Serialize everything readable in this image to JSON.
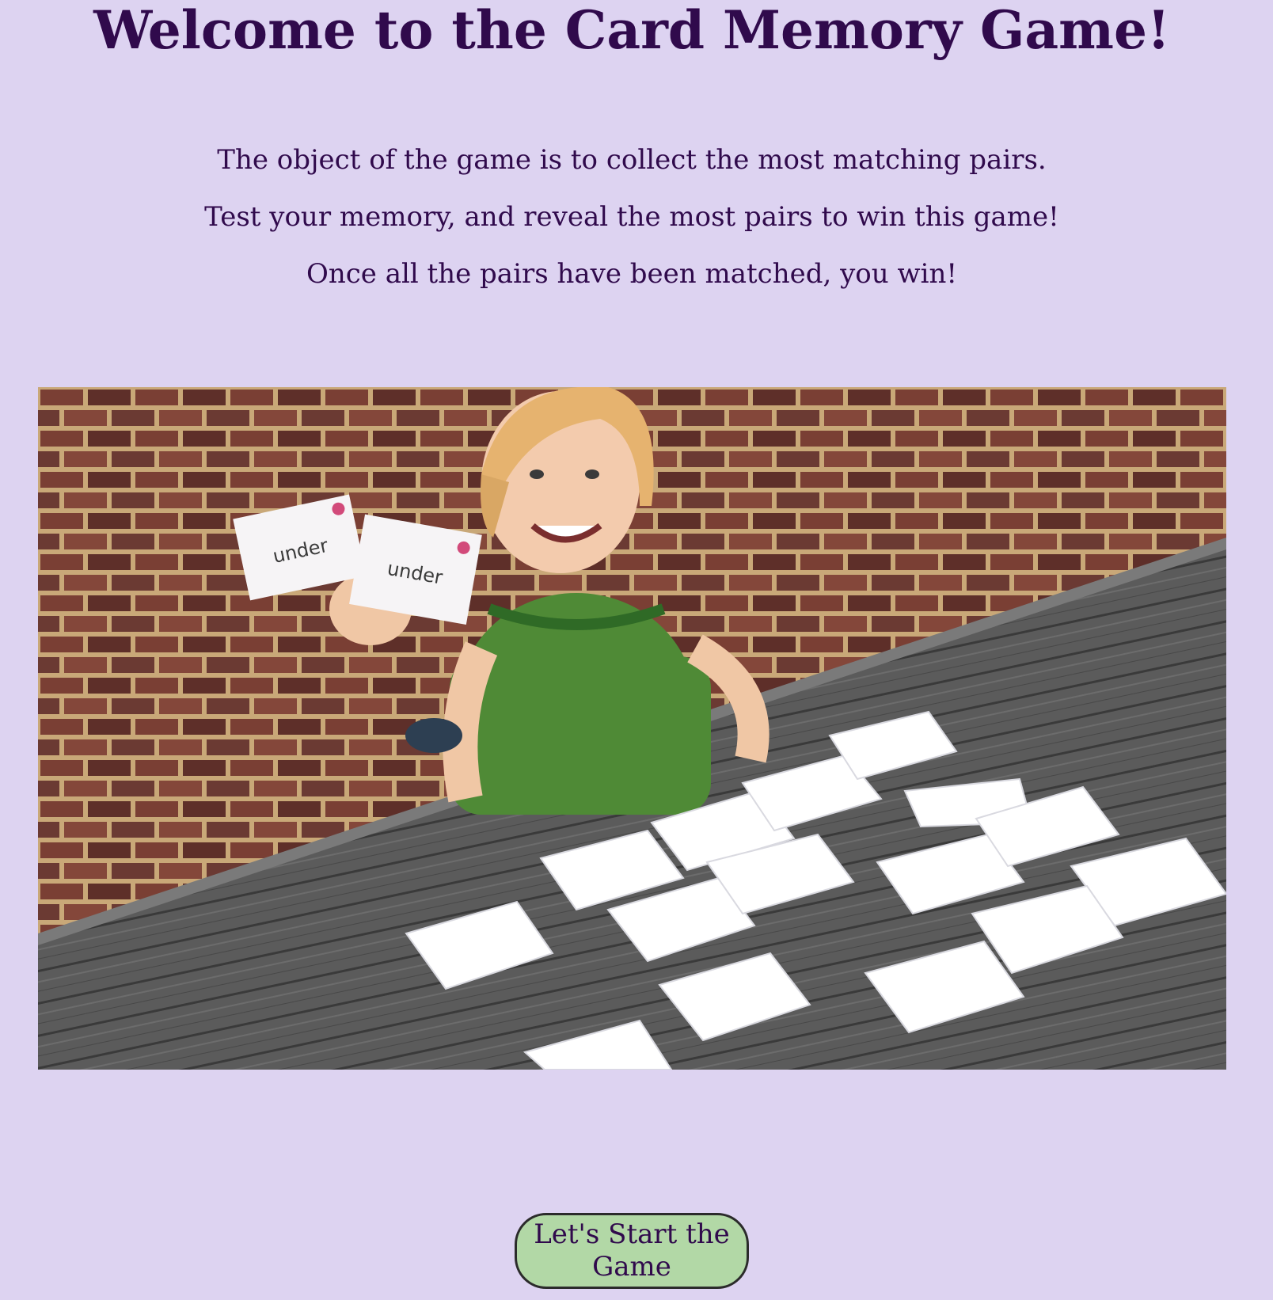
{
  "page": {
    "title": "Welcome to the Card Memory Game!",
    "intro": [
      "The object of the game is to collect the most matching pairs.",
      "Test your memory, and reveal the most pairs to win this game!",
      "Once all the pairs have been matched, you win!"
    ],
    "hero_card_word": "under",
    "start_button_label": "Let's Start the Game"
  },
  "colors": {
    "background": "#ddd3f1",
    "text": "#300a4c",
    "button_fill": "#b2d8a6"
  }
}
